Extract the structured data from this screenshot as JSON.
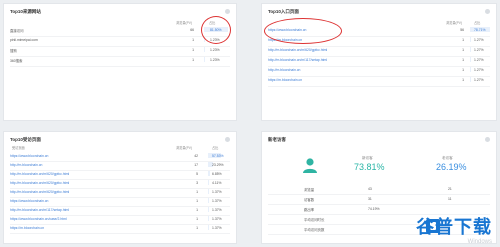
{
  "cards": {
    "referrers": {
      "title": "Top10来源网站",
      "col_visits": "浏览量(PV)",
      "col_pct": "占比",
      "rows": [
        {
          "label": "直接访问",
          "pv": "66",
          "pct": "81.50%",
          "bar": 0.815
        },
        {
          "label": "pinli.mimeipai.com",
          "pv": "1",
          "pct": "1.23%",
          "bar": 0.0123
        },
        {
          "label": "搜狗",
          "pv": "1",
          "pct": "1.23%",
          "bar": 0.0123
        },
        {
          "label": "360搜索",
          "pv": "1",
          "pct": "1.23%",
          "bar": 0.0123
        }
      ]
    },
    "entries": {
      "title": "Top10入口页面",
      "col_visits": "浏览量(PV)",
      "col_pct": "占比",
      "rows": [
        {
          "label": "https://www.bloorchain.cn",
          "pv": "56",
          "pct": "78.71%",
          "bar": 0.7871
        },
        {
          "label": "https://m.bloorchain.cn",
          "pv": "1",
          "pct": "1.27%",
          "bar": 0.0127
        },
        {
          "label": "http://m.bloorchain.cn/m/620/gpfcc.html",
          "pv": "1",
          "pct": "1.27%",
          "bar": 0.0127
        },
        {
          "label": "http://m.bloorchain.cn/m/117/setap.html",
          "pv": "1",
          "pct": "1.27%",
          "bar": 0.0127
        },
        {
          "label": "http://m.bloorchain.cn",
          "pv": "1",
          "pct": "1.27%",
          "bar": 0.0127
        },
        {
          "label": "https://m.bloorchain.cn",
          "pv": "1",
          "pct": "1.27%",
          "bar": 0.0127
        }
      ]
    },
    "visited": {
      "title": "Top10受访页面",
      "col_page": "受访页面",
      "col_visits": "浏览量(PV)",
      "col_pct": "占比",
      "rows": [
        {
          "label": "https://www.bloorchain.cn",
          "pv": "42",
          "pct": "57.53%",
          "bar": 0.5753
        },
        {
          "label": "http://m.bloorchain.cn",
          "pv": "17",
          "pct": "23.29%",
          "bar": 0.2329
        },
        {
          "label": "http://m.bloorchain.cn/m/620/gpfcc.html",
          "pv": "5",
          "pct": "6.85%",
          "bar": 0.0685
        },
        {
          "label": "http://m.bloorchain.cn/m/620/gpfcc.html",
          "pv": "3",
          "pct": "4.11%",
          "bar": 0.0411
        },
        {
          "label": "http://m.bloorchain.cn/m/620/gpfcc.html",
          "pv": "1",
          "pct": "1.37%",
          "bar": 0.0137
        },
        {
          "label": "https://www.bloorchain.cn",
          "pv": "1",
          "pct": "1.37%",
          "bar": 0.0137
        },
        {
          "label": "http://m.bloorchain.cn/m/117/setap.html",
          "pv": "1",
          "pct": "1.37%",
          "bar": 0.0137
        },
        {
          "label": "https://www.bloorchain.cn/case/2.html",
          "pv": "1",
          "pct": "1.37%",
          "bar": 0.0137
        },
        {
          "label": "https://m.bloorchain.cn",
          "pv": "1",
          "pct": "1.37%",
          "bar": 0.0137
        }
      ]
    },
    "visitors": {
      "title": "新老访客",
      "new_label": "新访客",
      "new_value": "73.81%",
      "old_label": "老访客",
      "old_value": "26.19%",
      "rows": [
        {
          "label": "浏览量",
          "new": "43",
          "old": "21"
        },
        {
          "label": "访客数",
          "new": "31",
          "old": "11"
        },
        {
          "label": "跳出率",
          "new": "74.19%",
          "old": ""
        },
        {
          "label": "平均访问时长",
          "new": "",
          "old": ""
        },
        {
          "label": "平均访问页数",
          "new": "",
          "old": ""
        }
      ]
    }
  },
  "watermark": {
    "text": "谷普下载",
    "faint": "Windows"
  },
  "colors": {
    "accent": "#3a7bd5",
    "teal": "#29b5a6",
    "highlight": "#d33"
  }
}
